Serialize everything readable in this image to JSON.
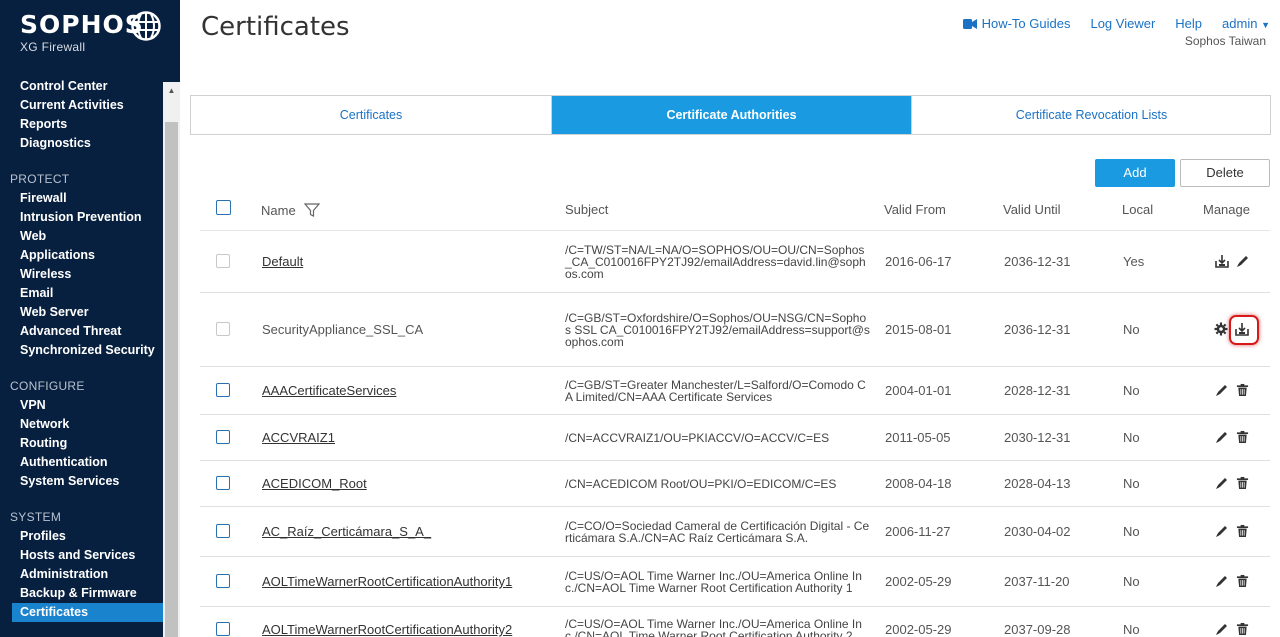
{
  "brand": {
    "name": "SOPHOS",
    "product": "XG Firewall"
  },
  "sidebar": {
    "top_items": [
      "Control Center",
      "Current Activities",
      "Reports",
      "Diagnostics"
    ],
    "sections": [
      {
        "title": "PROTECT",
        "items": [
          "Firewall",
          "Intrusion Prevention",
          "Web",
          "Applications",
          "Wireless",
          "Email",
          "Web Server",
          "Advanced Threat",
          "Synchronized Security"
        ]
      },
      {
        "title": "CONFIGURE",
        "items": [
          "VPN",
          "Network",
          "Routing",
          "Authentication",
          "System Services"
        ]
      },
      {
        "title": "SYSTEM",
        "items": [
          "Profiles",
          "Hosts and Services",
          "Administration",
          "Backup & Firmware",
          "Certificates"
        ]
      }
    ],
    "active_item": "Certificates"
  },
  "header": {
    "title": "Certificates",
    "howto": "How-To Guides",
    "log_viewer": "Log Viewer",
    "help": "Help",
    "admin": "admin",
    "org": "Sophos Taiwan"
  },
  "tabs": [
    {
      "label": "Certificates",
      "active": false
    },
    {
      "label": "Certificate Authorities",
      "active": true
    },
    {
      "label": "Certificate Revocation Lists",
      "active": false
    }
  ],
  "actions": {
    "add": "Add",
    "delete": "Delete"
  },
  "table": {
    "headers": {
      "name": "Name",
      "subject": "Subject",
      "valid_from": "Valid From",
      "valid_until": "Valid Until",
      "local": "Local",
      "manage": "Manage"
    },
    "rows": [
      {
        "name": "Default",
        "subject": "/C=TW/ST=NA/L=NA/O=SOPHOS/OU=OU/CN=Sophos_CA_C010016FPY2TJ92/emailAddress=david.lin@sophos.com",
        "from": "2016-06-17",
        "until": "2036-12-31",
        "local": "Yes",
        "icons": [
          "download-icon",
          "edit-icon"
        ]
      },
      {
        "name": "SecurityAppliance_SSL_CA",
        "subject": "/C=GB/ST=Oxfordshire/O=Sophos/OU=NSG/CN=Sophos SSL CA_C010016FPY2TJ92/emailAddress=support@sophos.com",
        "from": "2015-08-01",
        "until": "2036-12-31",
        "local": "No",
        "icons": [
          "gear-icon",
          "download-icon"
        ]
      },
      {
        "name": "AAACertificateServices",
        "subject": "/C=GB/ST=Greater Manchester/L=Salford/O=Comodo CA Limited/CN=AAA Certificate Services",
        "from": "2004-01-01",
        "until": "2028-12-31",
        "local": "No",
        "icons": [
          "edit-icon",
          "trash-icon"
        ]
      },
      {
        "name": "ACCVRAIZ1",
        "subject": "/CN=ACCVRAIZ1/OU=PKIACCV/O=ACCV/C=ES",
        "from": "2011-05-05",
        "until": "2030-12-31",
        "local": "No",
        "icons": [
          "edit-icon",
          "trash-icon"
        ]
      },
      {
        "name": "ACEDICOM_Root",
        "subject": "/CN=ACEDICOM Root/OU=PKI/O=EDICOM/C=ES",
        "from": "2008-04-18",
        "until": "2028-04-13",
        "local": "No",
        "icons": [
          "edit-icon",
          "trash-icon"
        ]
      },
      {
        "name": "AC_Raíz_Certicámara_S_A_",
        "subject": "/C=CO/O=Sociedad Cameral de Certificación Digital - Certicámara S.A./CN=AC Raíz Certicámara S.A.",
        "from": "2006-11-27",
        "until": "2030-04-02",
        "local": "No",
        "icons": [
          "edit-icon",
          "trash-icon"
        ]
      },
      {
        "name": "AOLTimeWarnerRootCertificationAuthority1",
        "subject": "/C=US/O=AOL Time Warner Inc./OU=America Online Inc./CN=AOL Time Warner Root Certification Authority 1",
        "from": "2002-05-29",
        "until": "2037-11-20",
        "local": "No",
        "icons": [
          "edit-icon",
          "trash-icon"
        ]
      },
      {
        "name": "AOLTimeWarnerRootCertificationAuthority2",
        "subject": "/C=US/O=AOL Time Warner Inc./OU=America Online Inc./CN=AOL Time Warner Root Certification Authority 2",
        "from": "2002-05-29",
        "until": "2037-09-28",
        "local": "No",
        "icons": [
          "edit-icon",
          "trash-icon"
        ]
      }
    ]
  },
  "colors": {
    "sidebar_bg": "#08203f",
    "accent": "#1a9ae0",
    "link": "#1a72c4",
    "highlight": "#d61a1a"
  }
}
